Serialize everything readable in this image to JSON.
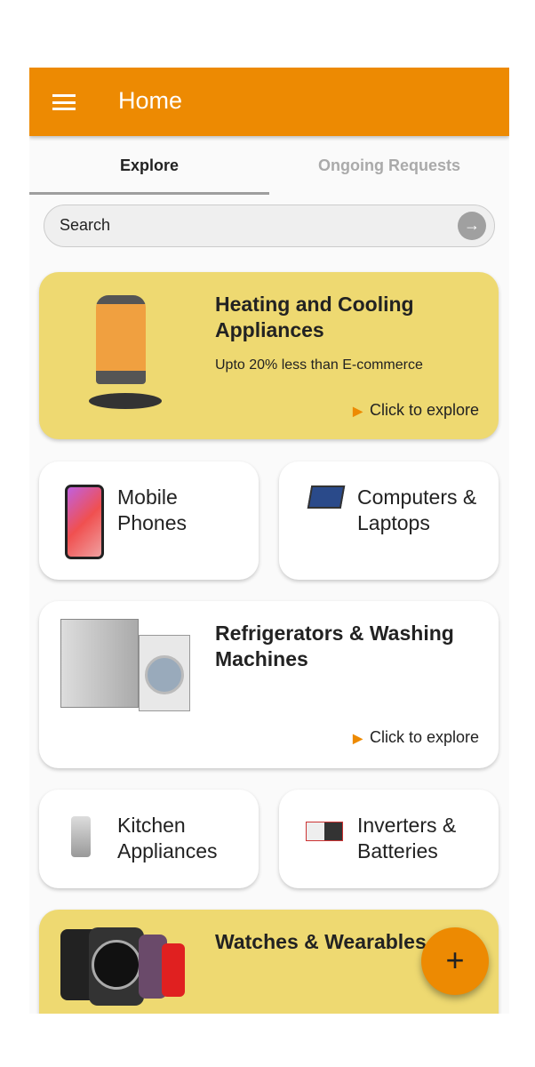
{
  "appbar": {
    "title": "Home",
    "menu_icon": "hamburger-icon"
  },
  "tabs": [
    {
      "label": "Explore",
      "active": true
    },
    {
      "label": "Ongoing Requests",
      "active": false
    }
  ],
  "search": {
    "placeholder": "Search",
    "button_icon": "arrow-right-icon"
  },
  "cards": [
    {
      "title": "Heating and Cooling Appliances",
      "subtitle": "Upto 20% less than E-commerce",
      "cta": "Click to explore"
    },
    {
      "title": "Mobile Phones"
    },
    {
      "title": "Computers & Laptops"
    },
    {
      "title": "Refrigerators & Washing Machines",
      "cta": "Click to explore"
    },
    {
      "title": "Kitchen Appliances"
    },
    {
      "title": "Inverters & Batteries"
    },
    {
      "title": "Watches & Wearables"
    }
  ],
  "fab": {
    "label": "+"
  },
  "colors": {
    "primary": "#ed8a02",
    "card_yellow": "#eed971"
  }
}
